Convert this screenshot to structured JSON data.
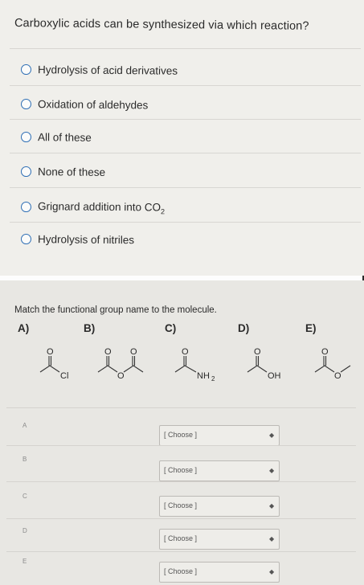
{
  "question1": {
    "prompt": "Carboxylic acids can be synthesized via which reaction?",
    "options": [
      "Hydrolysis of acid derivatives",
      "Oxidation of aldehydes",
      "All of these",
      "None of these",
      "Grignard addition into CO",
      "Hydrolysis of nitriles"
    ],
    "option5_subscript": "2"
  },
  "question2": {
    "prompt": "Match the functional group name to the molecule.",
    "columns": [
      "A)",
      "B)",
      "C)",
      "D)",
      "E)"
    ],
    "molecule_labels": {
      "cl": "Cl",
      "nh2": "NH",
      "nh2_sub": "2",
      "oh": "OH",
      "o": "O"
    },
    "rows": [
      {
        "letter": "A",
        "select": "[ Choose ]"
      },
      {
        "letter": "B",
        "select": "[ Choose ]"
      },
      {
        "letter": "C",
        "select": "[ Choose ]"
      },
      {
        "letter": "D",
        "select": "[ Choose ]"
      },
      {
        "letter": "E",
        "select": "[ Choose ]"
      }
    ]
  },
  "icons": {
    "select_arrow": "chevron-updown-icon",
    "radio": "radio-unselected-icon"
  }
}
